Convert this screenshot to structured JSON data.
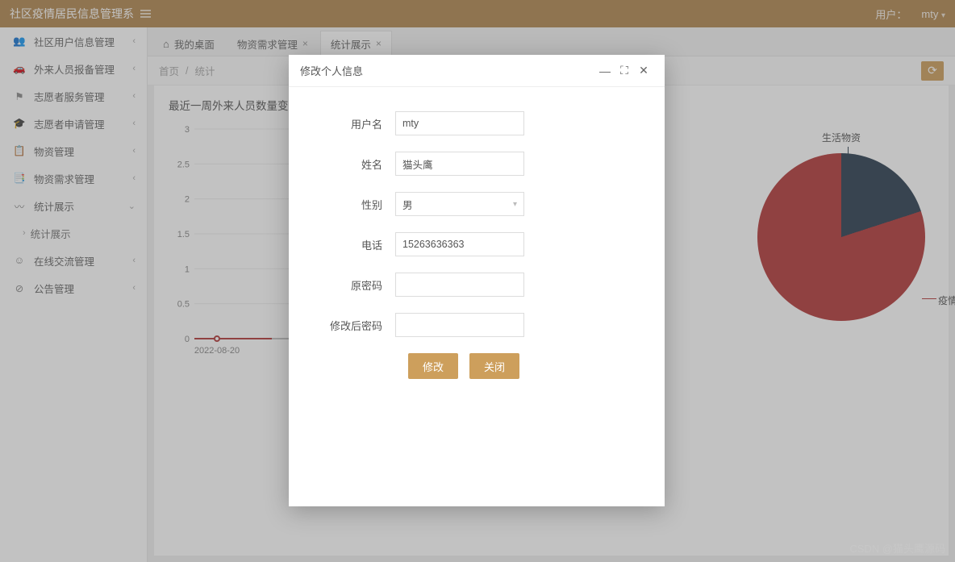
{
  "colors": {
    "accent": "#cd9f5c",
    "pie_A": "#2c3e50",
    "pie_B": "#b33939"
  },
  "topbar": {
    "title": "社区疫情居民信息管理系",
    "user_label": "用户：",
    "username": "mty"
  },
  "sidebar": {
    "items": [
      {
        "icon": "👥",
        "label": "社区用户信息管理",
        "arrow": "‹"
      },
      {
        "icon": "🚗",
        "label": "外来人员报备管理",
        "arrow": "‹"
      },
      {
        "icon": "⚑",
        "label": "志愿者服务管理",
        "arrow": "‹"
      },
      {
        "icon": "🎓",
        "label": "志愿者申请管理",
        "arrow": "‹"
      },
      {
        "icon": "📋",
        "label": "物资管理",
        "arrow": "‹"
      },
      {
        "icon": "📑",
        "label": "物资需求管理",
        "arrow": "‹"
      },
      {
        "icon": "〰",
        "label": "统计展示",
        "arrow": "⌄",
        "expanded": true,
        "sub": [
          {
            "label": "统计展示"
          }
        ]
      },
      {
        "icon": "☺",
        "label": "在线交流管理",
        "arrow": "‹"
      },
      {
        "icon": "⊘",
        "label": "公告管理",
        "arrow": "‹"
      }
    ]
  },
  "tabs": [
    {
      "label": "我的桌面",
      "home": true,
      "closable": false,
      "active": false
    },
    {
      "label": "物资需求管理",
      "closable": true,
      "active": false
    },
    {
      "label": "统计展示",
      "closable": true,
      "active": true
    }
  ],
  "breadcrumb": {
    "a": "首页",
    "sep": "/",
    "b": "统计"
  },
  "line_chart_title": "最近一周外来人员数量变化",
  "chart_data": {
    "type": "line",
    "title": "最近一周外来人员数量变化",
    "xlabel": "",
    "ylabel": "",
    "ylim": [
      0,
      3
    ],
    "yticks": [
      0,
      0.5,
      1,
      1.5,
      2,
      2.5,
      3
    ],
    "categories": [
      "2022-08-20"
    ],
    "values": [
      0
    ]
  },
  "pie": {
    "type": "pie",
    "series": [
      {
        "name": "生活物资",
        "value": 20,
        "color": "#2c3e50"
      },
      {
        "name": "疫情物资",
        "value": 80,
        "color": "#b33939"
      }
    ]
  },
  "modal": {
    "title": "修改个人信息",
    "fields": {
      "username_label": "用户名",
      "username_value": "mty",
      "name_label": "姓名",
      "name_value": "猫头鹰",
      "gender_label": "性别",
      "gender_value": "男",
      "phone_label": "电话",
      "phone_value": "15263636363",
      "oldpwd_label": "原密码",
      "oldpwd_value": "",
      "newpwd_label": "修改后密码",
      "newpwd_value": ""
    },
    "buttons": {
      "save": "修改",
      "close": "关闭"
    }
  },
  "watermark": "CSDN @猫头鹰源码"
}
